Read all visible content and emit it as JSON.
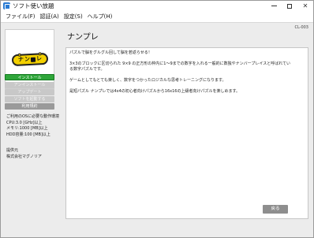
{
  "window": {
    "title": "ソフト使い放題",
    "screen_id": "CL-003"
  },
  "menu": [
    "ファイル(F)",
    "認証(A)",
    "設定(S)",
    "ヘルプ(H)"
  ],
  "logo": {
    "chars": [
      "ナ",
      "ン",
      "レ"
    ],
    "colors": {
      "sticker": "#f3d000",
      "outline": "#222222"
    }
  },
  "sidebar": {
    "install_label": "インストール",
    "uninstall_label": "アンインストール",
    "update_label": "アップデート",
    "launch_label": "ソフトを起動する",
    "terms_label": "利用規約"
  },
  "sysreq": {
    "heading": "ご利用のOSに必要な動作環境",
    "cpu": "CPU:3.0 [GHz]以上",
    "memory": "メモリ:1000 [MB]以上",
    "hdd": "HDD容量:100 [MB]以上"
  },
  "vendor": {
    "label": "提供元",
    "name": "株式会社マグノリア"
  },
  "app": {
    "title": "ナンプレ",
    "description": {
      "line1": "パズルで脳をグルグル回して脳を若返らせる！",
      "line2": "3×3のブロックに区切られた 9×9 の正方形の枠内に1～9までの数字を入れる一般的に数独やナンバープレイスと呼ばれてい",
      "line3": "る数字パズルです。",
      "line4": "ゲームとしてもとても楽しく、数字をつかったロジカルな思考トレーニングになります。",
      "line5": "是短パズル ナンプレでは4x4の初心者向けパズルから16x16の上級者向けパズルを楽しめます。"
    }
  },
  "footer": {
    "back_label": "戻る"
  },
  "colors": {
    "install_green": "#2fa63a",
    "disabled_gray": "#c8c8c8",
    "terms_gray": "#9a9a9a",
    "back_gray": "#8e8e8e",
    "client_bg": "#ececec"
  }
}
